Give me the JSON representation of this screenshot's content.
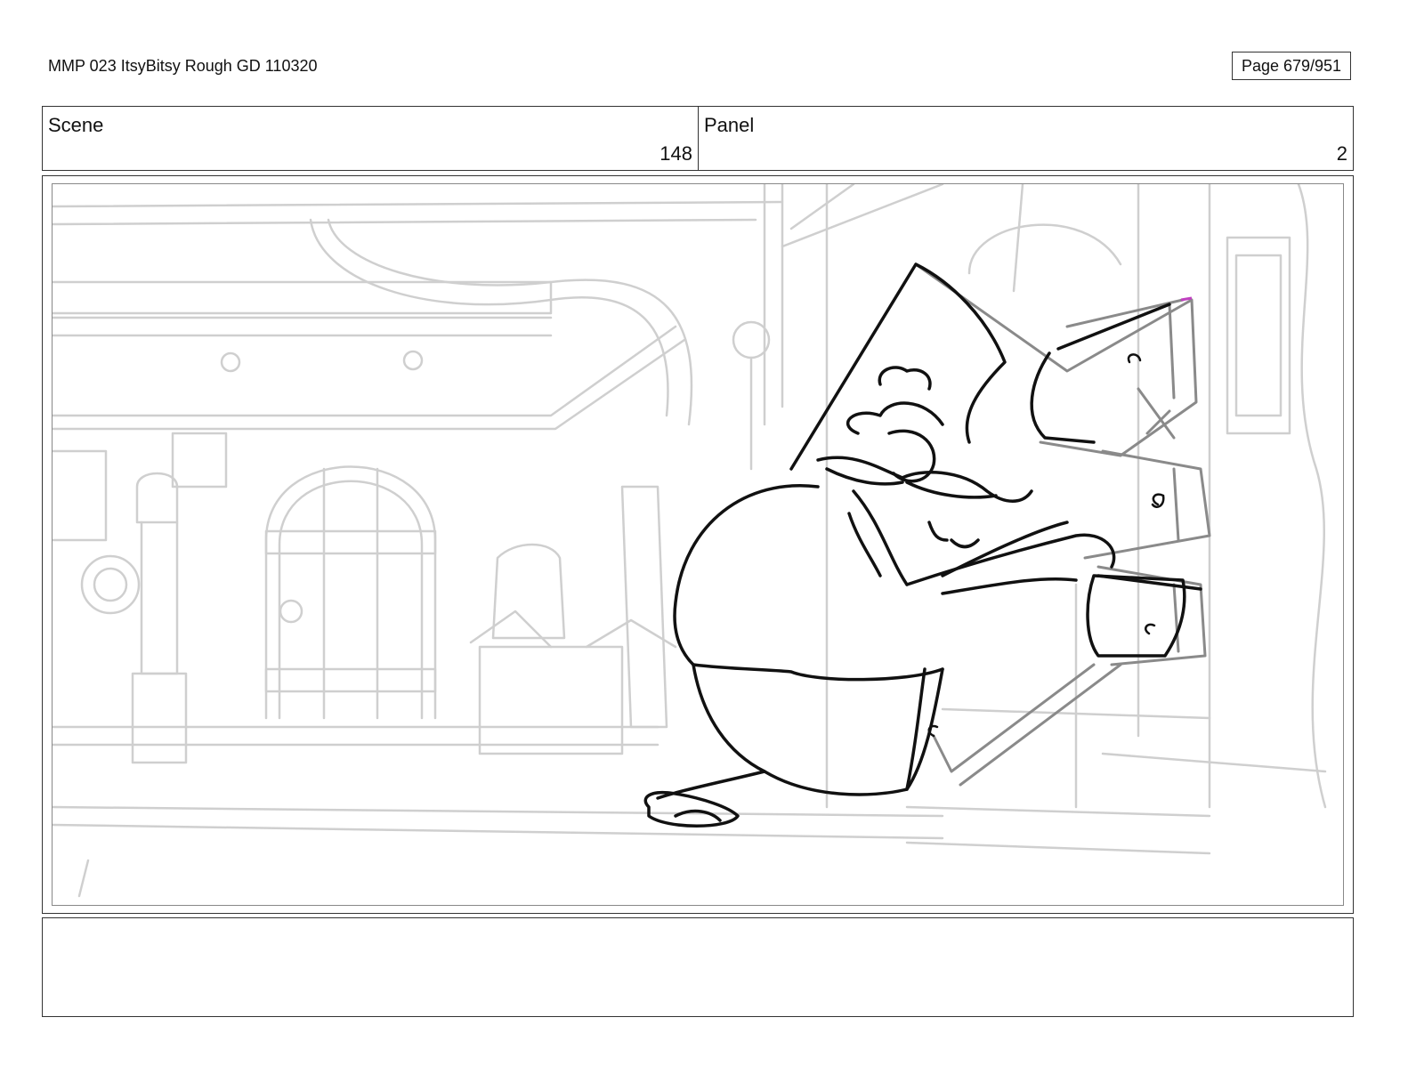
{
  "document": {
    "title": "MMP 023 ItsyBitsy Rough GD 110320",
    "page_label": "Page 679/951"
  },
  "header": {
    "scene_label": "Scene",
    "scene_number": "148",
    "panel_label": "Panel",
    "panel_number": "2"
  },
  "panel_image": {
    "description_icon": "storyboard-sketch-old-man-pulling-drawers"
  },
  "notes": {
    "text": ""
  },
  "colors": {
    "background_lines": "#cfcfcf",
    "character_lines": "#111111",
    "drawer_lines": "#8a8a8a",
    "accent_mark": "#c040c0"
  }
}
